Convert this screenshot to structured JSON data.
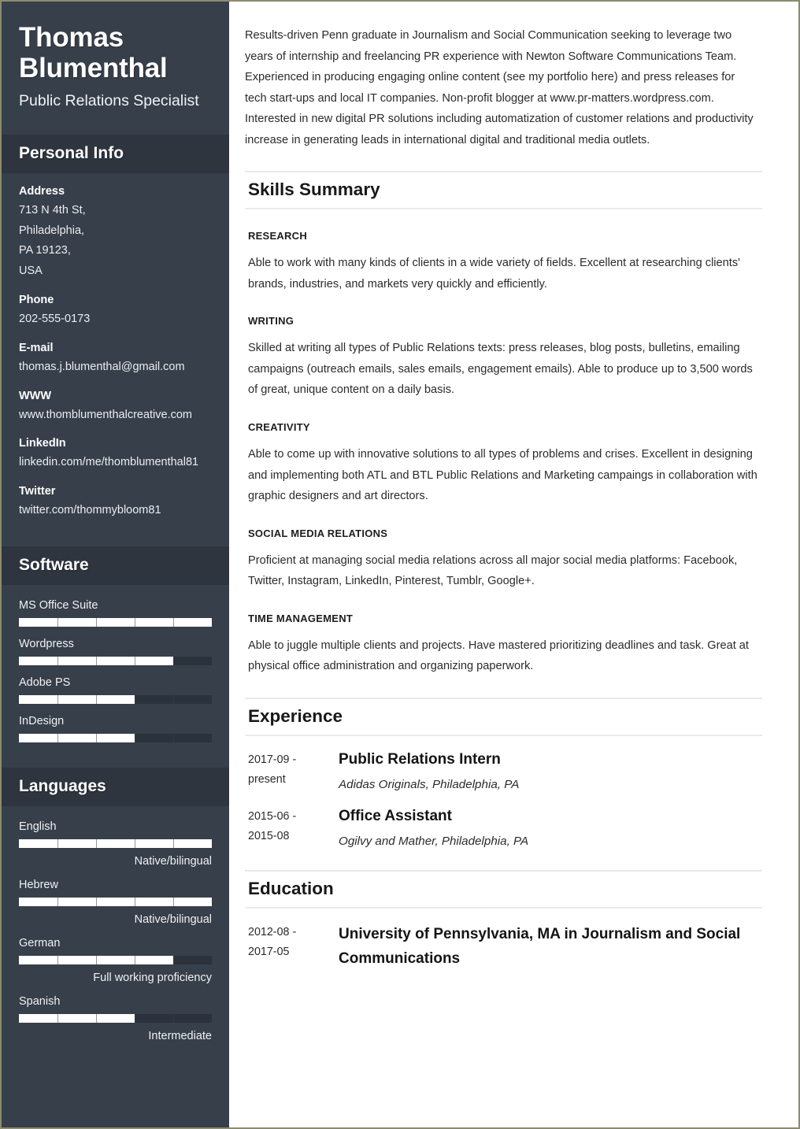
{
  "theme": {
    "sidebar_bg": "#373f4a",
    "sidebar_header_bg": "#2e353f",
    "bar_fill": "#ffffff",
    "bar_track": "#2b323c",
    "page_border": "#8b8b6e",
    "main_text": "#2b2b2b",
    "rule": "#e9e9e9"
  },
  "sidebar": {
    "full_name": "Thomas Blumenthal",
    "job_title": "Public Relations Specialist",
    "personal_info": {
      "heading": "Personal Info",
      "fields": [
        {
          "label": "Address",
          "value": "713 N 4th St, Philadelphia, PA 19123, USA",
          "lines": [
            "713 N 4th St,",
            "Philadelphia,",
            "PA 19123,",
            "USA"
          ]
        },
        {
          "label": "Phone",
          "value": "202-555-0173",
          "lines": [
            "202-555-0173"
          ]
        },
        {
          "label": "E-mail",
          "value": "thomas.j.blumenthal@gmail.com",
          "lines": [
            "thomas.j.blumenthal@gmail.com"
          ]
        },
        {
          "label": "WWW",
          "value": "www.thomblumenthalcreative.com",
          "lines": [
            "www.thomblumenthalcreative.com"
          ]
        },
        {
          "label": "LinkedIn",
          "value": "linkedin.com/me/thomblumenthal81",
          "lines": [
            "linkedin.com/me/thomblumenthal81"
          ]
        },
        {
          "label": "Twitter",
          "value": "twitter.com/thommybloom81",
          "lines": [
            "twitter.com/thommybloom81"
          ]
        }
      ]
    },
    "software": {
      "heading": "Software",
      "items": [
        {
          "label": "MS Office Suite",
          "percent": 100
        },
        {
          "label": "Wordpress",
          "percent": 80
        },
        {
          "label": "Adobe PS",
          "percent": 60
        },
        {
          "label": "InDesign",
          "percent": 60
        }
      ]
    },
    "languages": {
      "heading": "Languages",
      "items": [
        {
          "label": "English",
          "percent": 100,
          "note": "Native/bilingual"
        },
        {
          "label": "Hebrew",
          "percent": 100,
          "note": "Native/bilingual"
        },
        {
          "label": "German",
          "percent": 80,
          "note": "Full working proficiency"
        },
        {
          "label": "Spanish",
          "percent": 60,
          "note": "Intermediate"
        }
      ]
    }
  },
  "main": {
    "summary": "Results-driven Penn graduate in Journalism and Social Communication seeking to leverage two years of internship and freelancing PR experience with Newton Software Communications Team. Experienced in producing engaging online content (see my portfolio here) and press releases for tech start-ups and local IT companies. Non-profit blogger at www.pr-matters.wordpress.com. Interested in new digital PR solutions including automatization of customer relations and productivity increase in generating leads in international digital and traditional media outlets.",
    "skills_summary": {
      "heading": "Skills Summary",
      "skills": [
        {
          "name": "RESEARCH",
          "description": "Able to work with many kinds of clients in a wide variety of fields. Excellent at researching clients' brands, industries, and markets very quickly and efficiently."
        },
        {
          "name": "WRITING",
          "description": "Skilled at writing all types of Public Relations texts: press releases, blog posts, bulletins, emailing campaigns (outreach emails, sales emails, engagement emails). Able to produce up to 3,500 words of great, unique content on a daily basis."
        },
        {
          "name": "CREATIVITY",
          "description": "Able to come up with innovative solutions to all types of problems and crises. Excellent in designing and implementing both ATL and BTL Public Relations and Marketing campaings in collaboration with graphic designers and art directors."
        },
        {
          "name": "SOCIAL MEDIA RELATIONS",
          "description": "Proficient at managing social media relations across all major social media platforms: Facebook, Twitter, Instagram, LinkedIn, Pinterest, Tumblr, Google+."
        },
        {
          "name": "TIME MANAGEMENT",
          "description": "Able to juggle multiple clients and projects. Have mastered prioritizing deadlines and task. Great at physical office administration and organizing paperwork."
        }
      ]
    },
    "experience": {
      "heading": "Experience",
      "entries": [
        {
          "date_start": "2017-09 -",
          "date_end": "present",
          "role": "Public Relations Intern",
          "org": "Adidas Originals, Philadelphia, PA"
        },
        {
          "date_start": "2015-06 -",
          "date_end": "2015-08",
          "role": "Office Assistant",
          "org": "Ogilvy and Mather, Philadelphia, PA"
        }
      ]
    },
    "education": {
      "heading": "Education",
      "entries": [
        {
          "date_start": "2012-08 -",
          "date_end": "2017-05",
          "degree": "University of Pennsylvania, MA in Journalism and Social Communications"
        }
      ]
    }
  }
}
